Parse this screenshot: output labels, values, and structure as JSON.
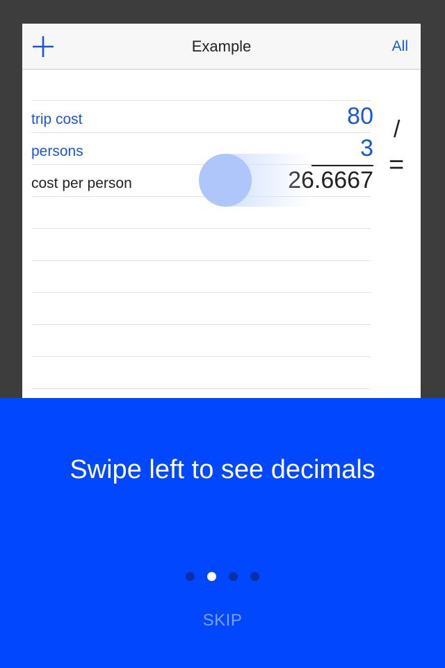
{
  "navbar": {
    "title": "Example",
    "all_label": "All",
    "add_icon": "plus-icon"
  },
  "rows": [
    {
      "label": "trip cost",
      "value": "80",
      "role": "input"
    },
    {
      "label": "persons",
      "value": "3",
      "role": "input"
    },
    {
      "label": "cost per person",
      "value": "26.6667",
      "role": "result"
    }
  ],
  "operators": {
    "divide": "/",
    "equals": "="
  },
  "tutorial": {
    "message": "Swipe left to see decimals",
    "page_count": 4,
    "active_page": 2,
    "skip_label": "SKIP"
  },
  "colors": {
    "accent": "#1a55e0",
    "tutorial_bg": "#0047fd",
    "outer_bg": "#3d3d3d",
    "swipe_hint": "#afc6fb"
  }
}
